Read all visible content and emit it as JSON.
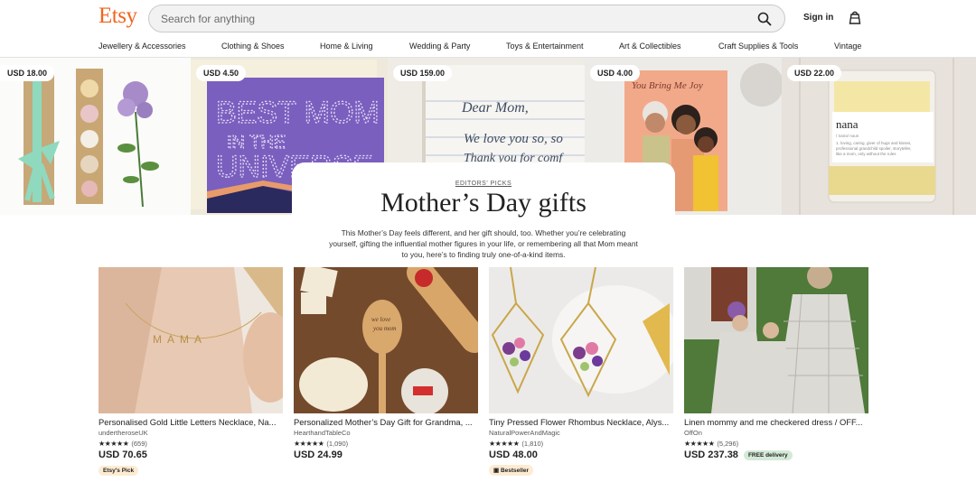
{
  "header": {
    "logo": "Etsy",
    "search_placeholder": "Search for anything",
    "sign_in": "Sign in"
  },
  "nav": {
    "items": [
      "Jewellery & Accessories",
      "Clothing & Shoes",
      "Home & Living",
      "Wedding & Party",
      "Toys & Entertainment",
      "Art & Collectibles",
      "Craft Supplies & Tools",
      "Vintage"
    ]
  },
  "banner": {
    "items": [
      {
        "price": "USD 18.00"
      },
      {
        "price": "USD 4.50"
      },
      {
        "price": "USD 159.00"
      },
      {
        "price": "USD 4.00"
      },
      {
        "price": "USD 22.00"
      }
    ]
  },
  "editors": {
    "eyebrow": "EDITORS' PICKS",
    "title": "Mother’s Day gifts",
    "description": "This Mother’s Day feels different, and her gift should, too. Whether you’re celebrating yourself, gifting the influential mother figures in your life, or remembering all that Mom meant to you, here’s to finding truly one-of-a-kind items."
  },
  "products": [
    {
      "title": "Personalised Gold Little Letters Necklace, Na...",
      "shop": "undertheroseUK",
      "stars": "★★★★★",
      "reviews": "(659)",
      "price": "USD 70.65",
      "badge": "Etsy's Pick"
    },
    {
      "title": "Personalized Mother’s Day Gift for Grandma, ...",
      "shop": "HearthandTableCo",
      "stars": "★★★★★",
      "reviews": "(1,090)",
      "price": "USD 24.99",
      "badge": ""
    },
    {
      "title": "Tiny Pressed Flower Rhombus Necklace, Alys...",
      "shop": "NaturalPowerAndMagic",
      "stars": "★★★★★",
      "reviews": "(1,810)",
      "price": "USD 48.00",
      "badge": "Bestseller"
    },
    {
      "title": "Linen mommy and me checkered dress / OFF...",
      "shop": "OffOn",
      "stars": "★★★★★",
      "reviews": "(5,296)",
      "price": "USD 237.38",
      "badge": "FREE delivery"
    }
  ],
  "images": {
    "banner_0": "soap gift box with green ribbon and lilac flowers",
    "banner_1": "purple card with stars",
    "banner_2": "embroidered handwriting blanket",
    "banner_3": "illustrated card of three women",
    "banner_4": "candle in glass jar",
    "product_0": "gold letters necklace on neck",
    "product_1": "engraved wooden spoon with rolling pin",
    "product_2": "pressed flower rhombus pendants",
    "product_3": "mother and daughters in gingham dresses"
  },
  "colors": {
    "brand": "#f1641e",
    "star": "#222222"
  }
}
